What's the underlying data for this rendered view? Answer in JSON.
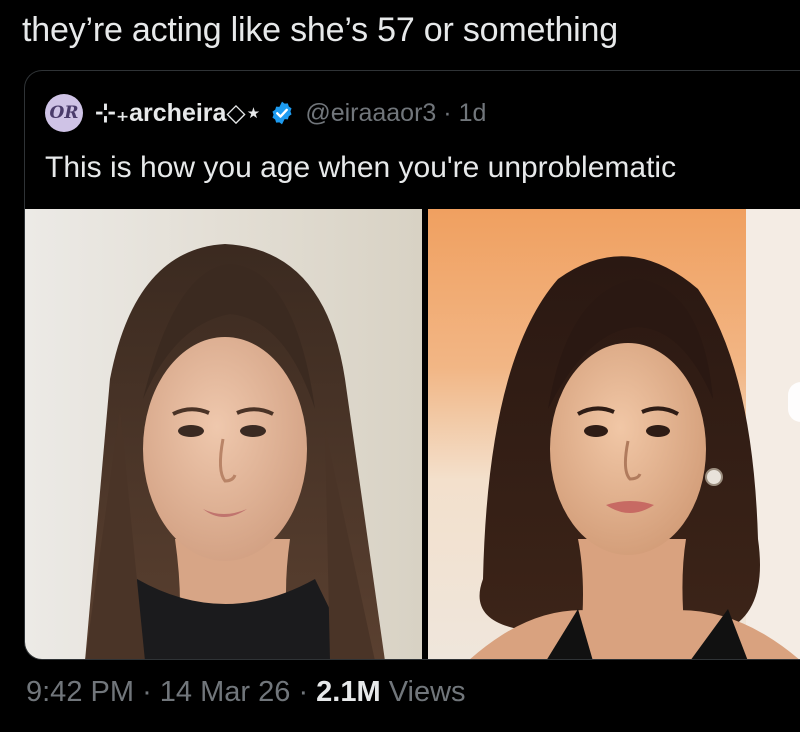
{
  "tweet": {
    "text": "they’re acting like she’s 57 or something",
    "time": "9:42 PM",
    "date": "14 Mar 26",
    "views_count": "2.1M",
    "views_label": "Views",
    "separator": "·"
  },
  "quoted_tweet": {
    "avatar_initials": "OR",
    "display_name": "⊹₊archeira◇⋆",
    "handle": "@eiraaaor3",
    "separator": "·",
    "age": "1d",
    "text": "This is how you age when you're unproblematic",
    "verified": true,
    "verified_color": "#1d9bf0",
    "media": [
      {
        "name": "photo-left",
        "subject": "younger portrait"
      },
      {
        "name": "photo-right",
        "subject": "older portrait"
      }
    ]
  },
  "colors": {
    "background": "#000000",
    "primary_text": "#e7e9ea",
    "secondary_text": "#71767b",
    "border": "#2f3336"
  }
}
